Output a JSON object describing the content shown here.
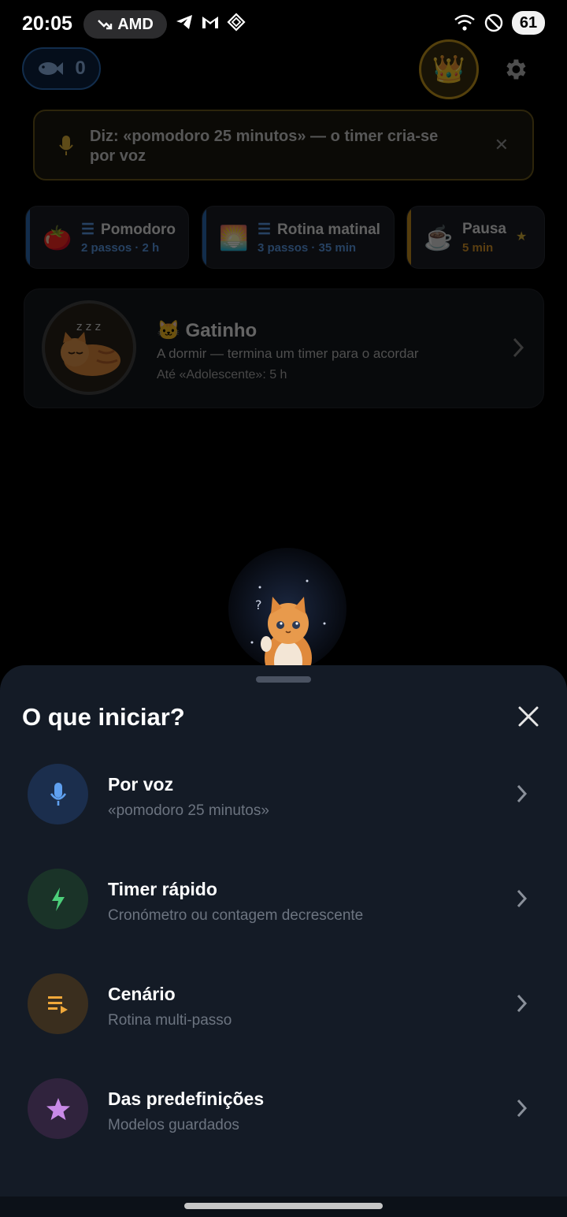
{
  "status": {
    "time": "20:05",
    "pill_label": "AMD",
    "battery": "61"
  },
  "header": {
    "fish_count": "0"
  },
  "voice_banner": {
    "text": "Diz: «pomodoro 25 minutos» — o timer cria-se por voz"
  },
  "presets": [
    {
      "title": "Pomodoro",
      "meta": "2 passos · 2 h",
      "icon": "tomato-icon",
      "stripe": "#2d6db5",
      "meta_color": "#5b9be8"
    },
    {
      "title": "Rotina matinal",
      "meta": "3 passos · 35 min",
      "icon": "sunrise-icon",
      "stripe": "#2d6db5",
      "meta_color": "#5b9be8"
    },
    {
      "title": "Pausa",
      "meta": "5 min",
      "icon": "coffee-icon",
      "stripe": "#c8901e",
      "meta_color": "#d9972a"
    }
  ],
  "pet": {
    "title": "🐱 Gatinho",
    "subtitle": "A dormir — termina um timer para o acordar",
    "level": "Até «Adolescente»: 5 h"
  },
  "sheet": {
    "title": "O que iniciar?",
    "options": [
      {
        "title": "Por voz",
        "subtitle": "«pomodoro 25 minutos»",
        "icon": "mic-icon",
        "bg": "#1b2e4d",
        "color": "#5fa0f0"
      },
      {
        "title": "Timer rápido",
        "subtitle": "Cronómetro ou contagem decrescente",
        "icon": "bolt-icon",
        "bg": "#1a3328",
        "color": "#4ccf7a"
      },
      {
        "title": "Cenário",
        "subtitle": "Rotina multi-passo",
        "icon": "playlist-icon",
        "bg": "#3a2e1e",
        "color": "#f0a83a"
      },
      {
        "title": "Das predefinições",
        "subtitle": "Modelos guardados",
        "icon": "star-icon",
        "bg": "#30233d",
        "color": "#c98ae8"
      }
    ]
  },
  "colors": {
    "sheet_bg": "#141b26",
    "accent_blue": "#2d6db5",
    "accent_gold": "#c89a1e"
  }
}
